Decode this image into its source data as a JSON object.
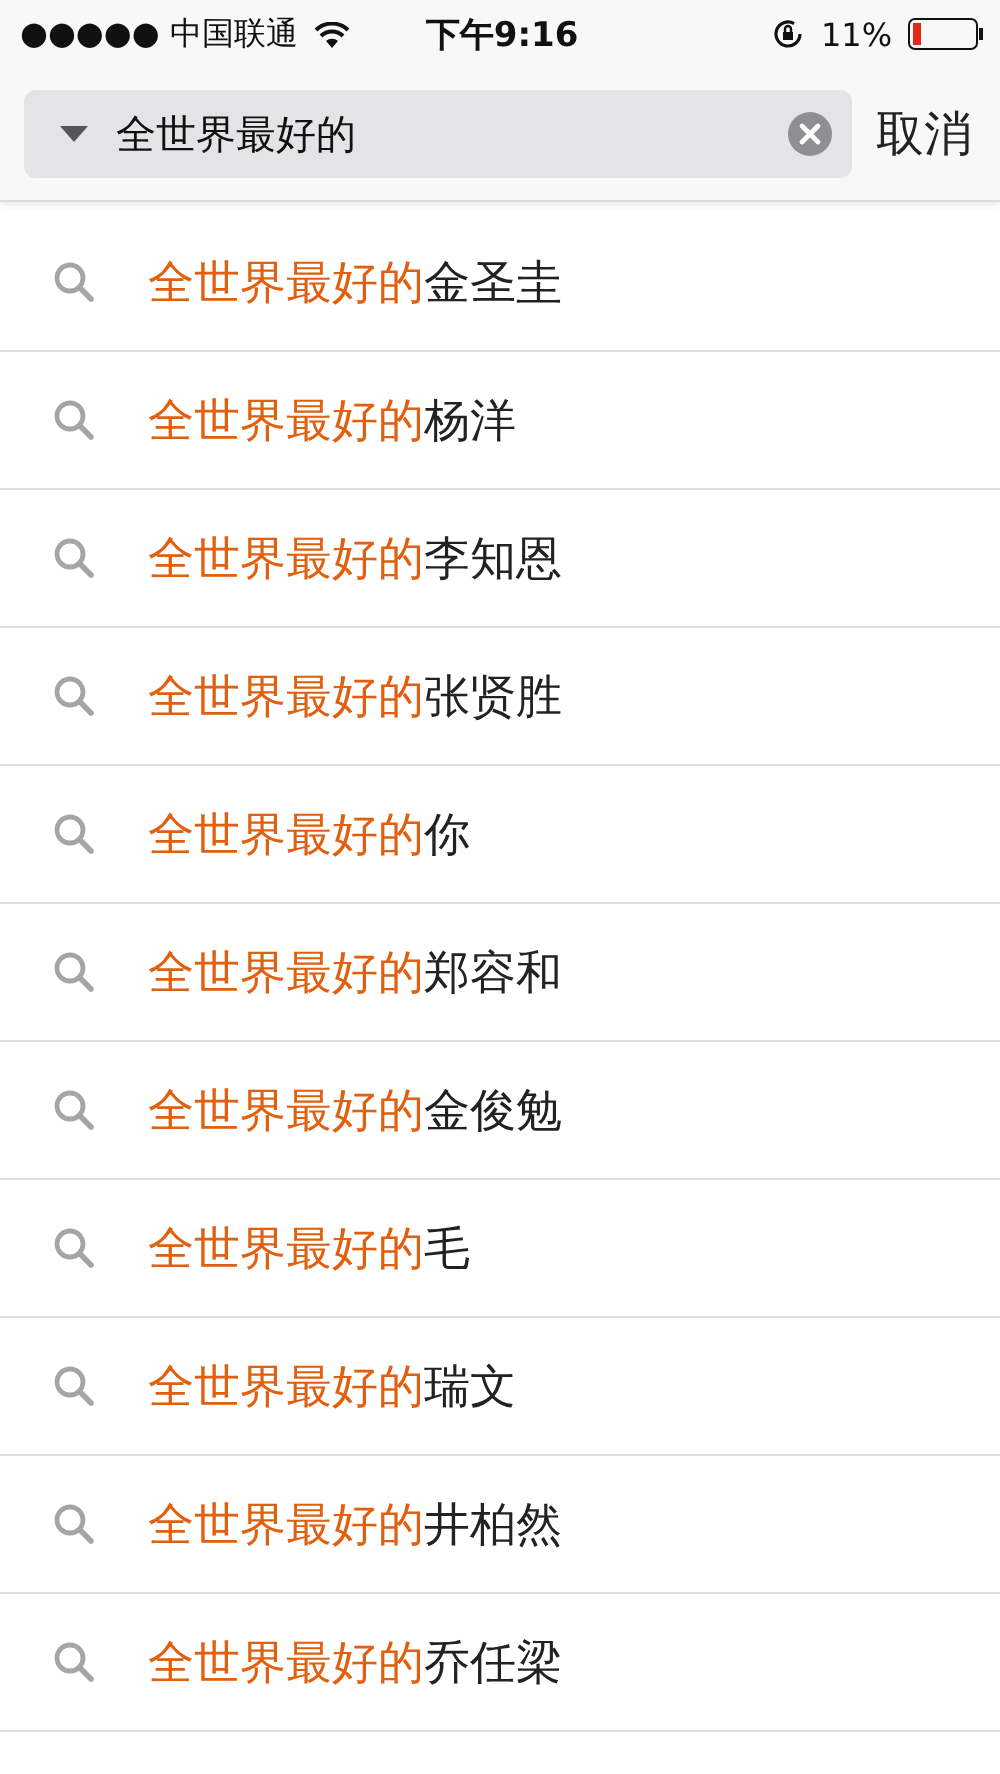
{
  "status_bar": {
    "carrier": "●●●●● 中国联通",
    "time": "下午9:16",
    "battery": "11%"
  },
  "search": {
    "value": "全世界最好的",
    "cancel": "取消"
  },
  "suggestions": [
    {
      "match": "全世界最好的",
      "rest": "金圣圭"
    },
    {
      "match": "全世界最好的",
      "rest": "杨洋"
    },
    {
      "match": "全世界最好的",
      "rest": "李知恩"
    },
    {
      "match": "全世界最好的",
      "rest": "张贤胜"
    },
    {
      "match": "全世界最好的",
      "rest": "你"
    },
    {
      "match": "全世界最好的",
      "rest": "郑容和"
    },
    {
      "match": "全世界最好的",
      "rest": "金俊勉"
    },
    {
      "match": "全世界最好的",
      "rest": "毛"
    },
    {
      "match": "全世界最好的",
      "rest": "瑞文"
    },
    {
      "match": "全世界最好的",
      "rest": "井柏然"
    },
    {
      "match": "全世界最好的",
      "rest": "乔任梁"
    }
  ]
}
